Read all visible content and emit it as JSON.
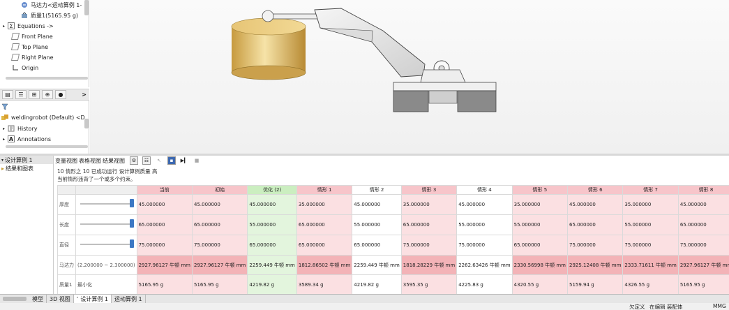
{
  "feature_tree": {
    "items_top": [
      {
        "label": "马达力<运动算例 1-",
        "icon": "motor-force-icon"
      },
      {
        "label": "质量1(5165.95 g)",
        "icon": "mass-icon"
      },
      {
        "label": "Equations ->",
        "icon": "equations-icon"
      },
      {
        "label": "Front Plane",
        "icon": "plane-icon"
      },
      {
        "label": "Top Plane",
        "icon": "plane-icon"
      },
      {
        "label": "Right Plane",
        "icon": "plane-icon"
      },
      {
        "label": "Origin",
        "icon": "origin-icon"
      }
    ],
    "tabs": [
      "feature-manager-icon",
      "property-manager-icon",
      "configuration-manager-icon",
      "dimxpert-icon",
      "display-manager-icon"
    ],
    "more_label": ">",
    "items_bottom": [
      {
        "label": "weldingrobot (Default) <D",
        "icon": "assembly-icon"
      },
      {
        "label": "History",
        "icon": "history-icon"
      },
      {
        "label": "Annotations",
        "icon": "annotations-icon"
      }
    ]
  },
  "left_panel": {
    "items": [
      "设计算例 1",
      "结果和图表"
    ]
  },
  "study": {
    "tabs": [
      "变量视图",
      "表格视图",
      "结果视图"
    ],
    "message_line1": "10 情形之 10 已成功运行 设计算例质量  高",
    "message_line2": "当前情形违背了一个或多个约束。",
    "columns": [
      "当前",
      "初始",
      "优化 (2)",
      "情形 1",
      "情形 2",
      "情形 3",
      "情形 4",
      "情形 5",
      "情形 6",
      "情形 7",
      "情形 8"
    ],
    "rows": [
      {
        "label": "厚度",
        "values": [
          "45.000000",
          "45.000000",
          "45.000000",
          "35.000000",
          "45.000000",
          "35.000000",
          "45.000000",
          "35.000000",
          "45.000000",
          "35.000000",
          "45.000000"
        ]
      },
      {
        "label": "长度",
        "values": [
          "65.000000",
          "65.000000",
          "55.000000",
          "65.000000",
          "55.000000",
          "65.000000",
          "55.000000",
          "55.000000",
          "65.000000",
          "55.000000",
          "65.000000"
        ]
      },
      {
        "label": "直径",
        "values": [
          "75.000000",
          "75.000000",
          "65.000000",
          "65.000000",
          "65.000000",
          "75.000000",
          "75.000000",
          "65.000000",
          "75.000000",
          "75.000000",
          "75.000000"
        ]
      },
      {
        "label": "马达力",
        "range": "(2.200000 ~ 2.300000)",
        "values": [
          "2927.96127 牛顿 mm",
          "2927.96127 牛顿 mm",
          "2259.449 牛顿 mm",
          "1812.86502 牛顿 mm",
          "2259.449 牛顿 mm",
          "1818.28229 牛顿 mm",
          "2262.63426 牛顿 mm",
          "2330.56998 牛顿 mm",
          "2925.12408 牛顿 mm",
          "2333.71611 牛顿 mm",
          "2927.96127 牛顿 mm"
        ]
      },
      {
        "label": "质量1",
        "sublabel": "最小化",
        "values": [
          "5165.95 g",
          "5165.95 g",
          "4219.82 g",
          "3589.34 g",
          "4219.82 g",
          "3595.35 g",
          "4225.83 g",
          "4320.55 g",
          "5159.94 g",
          "4326.55 g",
          "5165.95 g"
        ]
      }
    ]
  },
  "bottom_tabs": [
    "模型",
    "3D 视图",
    "设计算例 1",
    "运动算例 1"
  ],
  "status": {
    "left": "欠定义",
    "middle": "在编辑 装配体",
    "right": "MMG"
  },
  "colors": {
    "infeasible": "#fbe0e2",
    "optimal": "#e3f5dd",
    "selected_row_highlight": "#f3b3b7"
  }
}
